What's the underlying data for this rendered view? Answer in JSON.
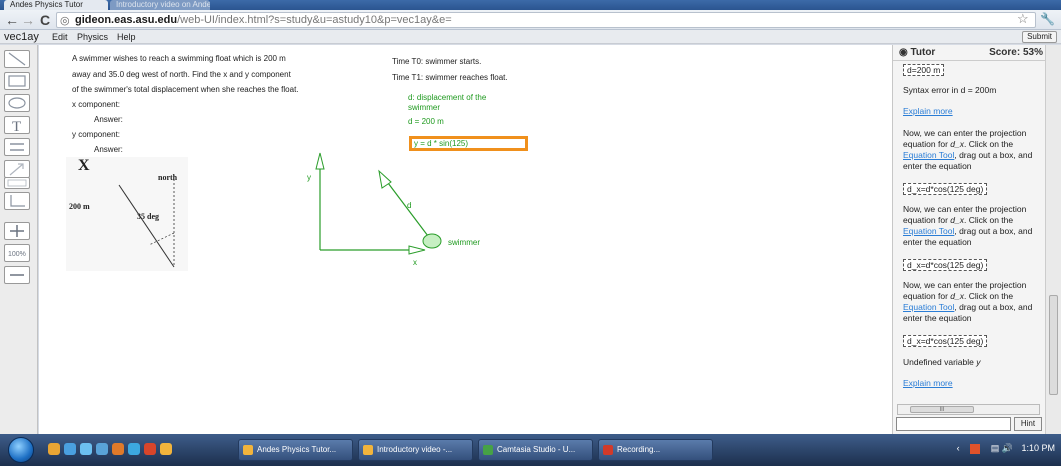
{
  "browser": {
    "tab_active": "Andes Physics Tutor",
    "tab_other": "Introductory video on Andes",
    "url_host": "gideon.eas.asu.edu",
    "url_path": "/web-UI/index.html?s=study&u=astudy10&p=vec1ay&e="
  },
  "app": {
    "name": "vec1ay",
    "menu_edit": "Edit",
    "menu_physics": "Physics",
    "menu_help": "Help",
    "submit_label": "Submit"
  },
  "problem": {
    "line1": "A swimmer wishes to reach a swimming float which is 200 m",
    "line2": "away and 35.0 deg west of north. Find the x and y component",
    "line3": "of the swimmer's total displacement when she reaches the float.",
    "x_component": "x component:",
    "answer1": "Answer:",
    "y_component": "y component:",
    "answer2": "Answer:"
  },
  "figure": {
    "big_x": "X",
    "north": "north",
    "distance": "200 m",
    "angle": "35 deg"
  },
  "times": {
    "t0": "Time T0: swimmer starts.",
    "t1": "Time T1: swimmer reaches float."
  },
  "definitions": {
    "d_line1": "d: displacement of the",
    "d_line2": "swimmer",
    "d_value": "d = 200 m",
    "equation": "y = d * sin(125)"
  },
  "diagram": {
    "y_label": "y",
    "x_label": "x",
    "d_label": "d",
    "swimmer_label": "swimmer"
  },
  "tutor": {
    "tab_label": "Tutor",
    "score": "Score: 53%",
    "entry1": "d=200 m",
    "syntax_error": "Syntax error in d = 200m",
    "explain_more_1": "Explain more",
    "hint_pre": "Now, we can enter the projection equation for ",
    "hint_var": "d_x",
    "hint_mid": ". Click on the ",
    "hint_link": "Equation Tool",
    "hint_post": ", drag out a box, and enter the equation",
    "equation_box": "d_x=d*cos(125 deg)",
    "undefined_pre": "Undefined variable ",
    "undefined_var": "y",
    "explain_more_2": "Explain more",
    "hscroll_label": "III",
    "hint_button": "Hint"
  },
  "taskbar": {
    "btn1": "Andes Physics Tutor...",
    "btn2": "Introductory video -...",
    "btn3": "Camtasia Studio - U...",
    "btn4": "Recording...",
    "clock": "1:10 PM"
  }
}
